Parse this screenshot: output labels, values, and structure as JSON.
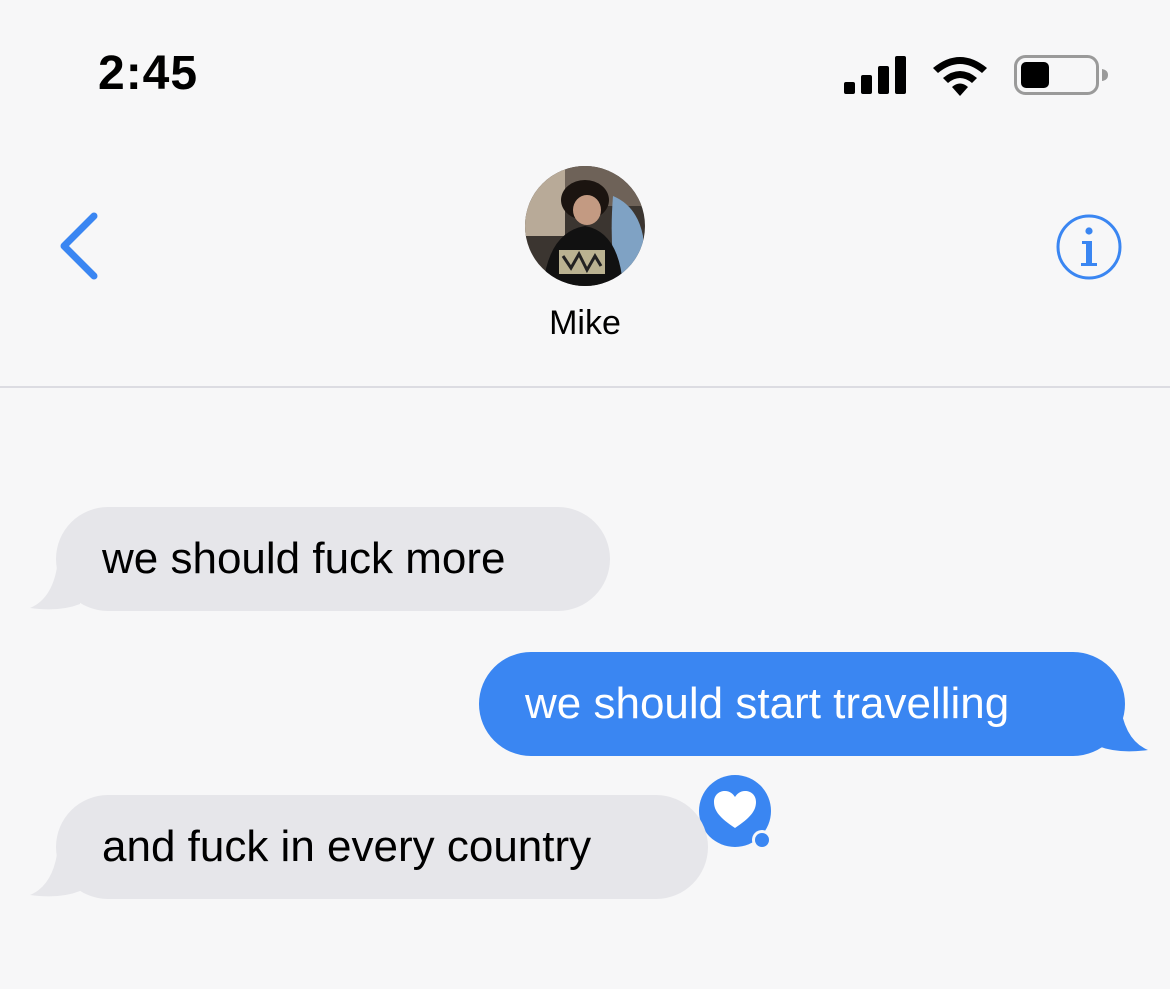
{
  "status_bar": {
    "time": "2:45",
    "signal_icon": "cellular-signal-icon",
    "wifi_icon": "wifi-icon",
    "battery_icon": "battery-icon",
    "battery_level": 0.35
  },
  "header": {
    "back_icon": "chevron-left-icon",
    "contact_name": "Mike",
    "avatar_icon": "contact-avatar",
    "info_icon": "info-icon"
  },
  "messages": [
    {
      "direction": "received",
      "text": "we should fuck more"
    },
    {
      "direction": "sent",
      "text": "we should start travelling",
      "tapback": "heart"
    },
    {
      "direction": "received",
      "text": "and fuck in every country"
    }
  ],
  "colors": {
    "accent": "#3a86f2",
    "sent_bubble": "#3a86f2",
    "received_bubble": "#e6e6ea",
    "background": "#f7f7f8"
  }
}
